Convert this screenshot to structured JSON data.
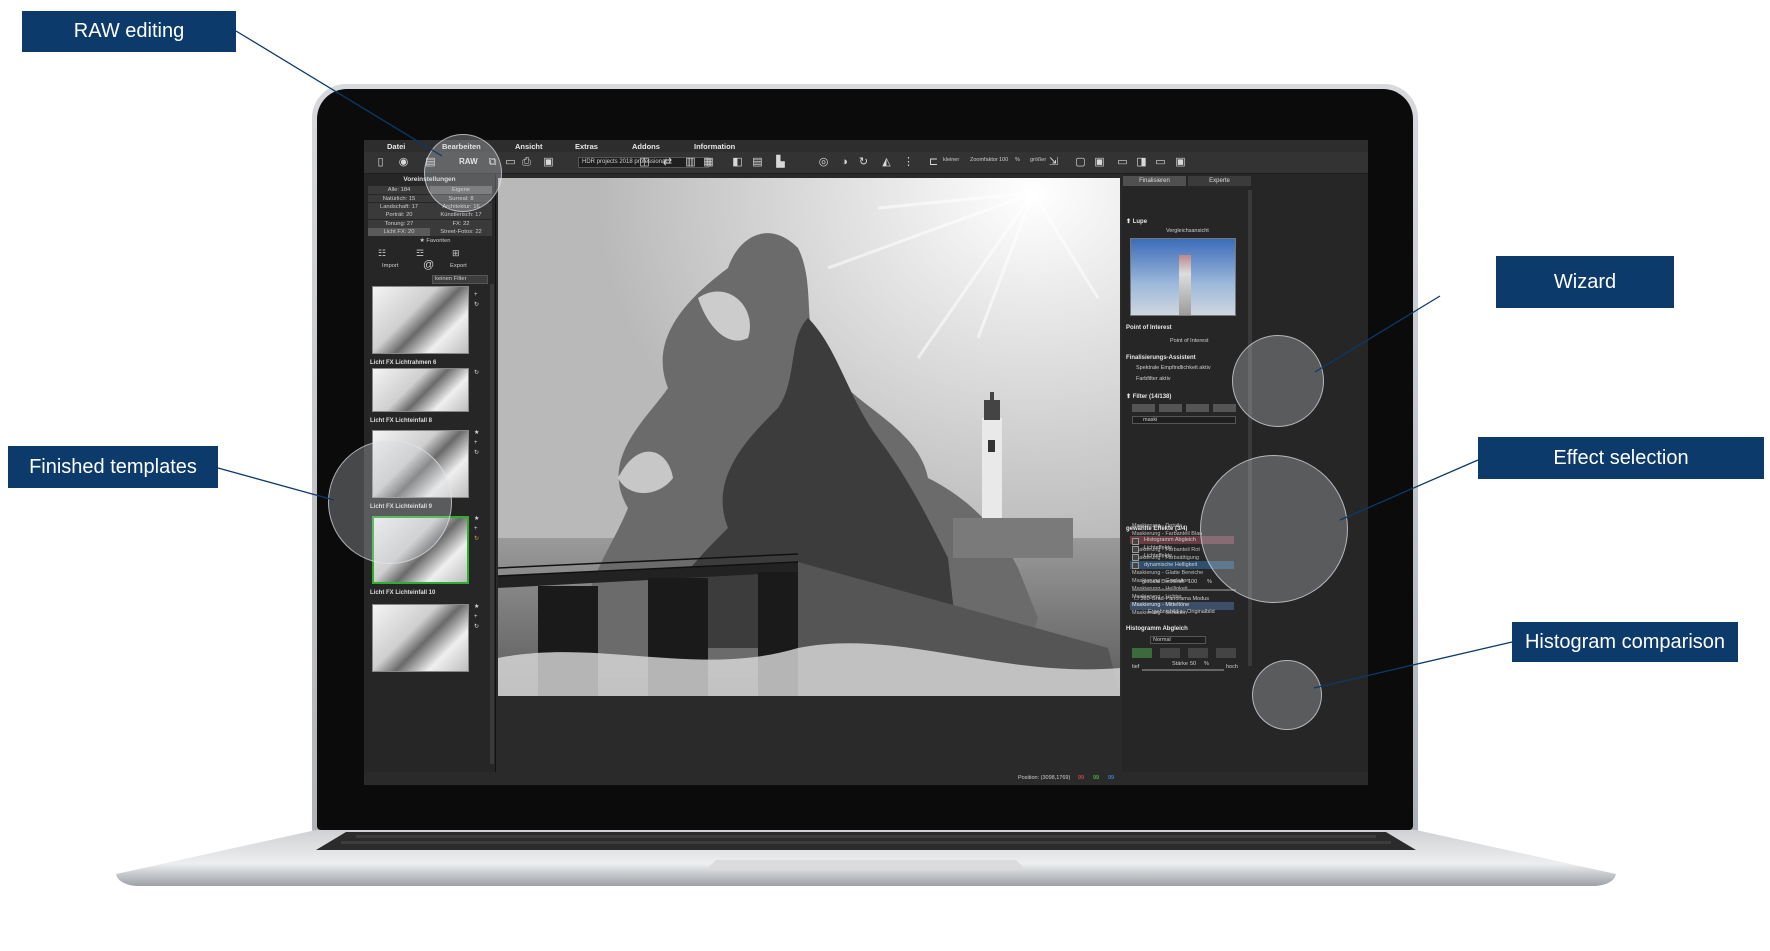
{
  "callouts": {
    "raw_editing": "RAW editing",
    "finished_templates": "Finished templates",
    "wizard": "Wizard",
    "effect_selection": "Effect selection",
    "histogram_comparison": "Histogram comparison"
  },
  "menu": [
    "Datei",
    "Bearbeiten",
    "Ansicht",
    "Extras",
    "Addons",
    "Information"
  ],
  "toolbar": {
    "raw_label": "RAW",
    "preset_dropdown": "HDR projects 2018 professional",
    "zoom_small": "kleiner",
    "zoom_label": "Zoomfaktor",
    "zoom_value": "100",
    "zoom_unit": "%",
    "zoom_large": "größer"
  },
  "left_panel": {
    "title": "Voreinstellungen",
    "categories": [
      [
        "Alle: 184",
        "Eigene"
      ],
      [
        "Natürlich: 15",
        "Surreal: 8"
      ],
      [
        "Landschaft: 17",
        "Architektur: 16"
      ],
      [
        "Porträt: 20",
        "Künstlerisch: 17"
      ],
      [
        "Tonung: 27",
        "FX: 22"
      ],
      [
        "Licht FX: 20",
        "Street-Fotos: 22"
      ]
    ],
    "favorites": "Favoriten",
    "import": "Import",
    "export": "Export",
    "filter": "keinen Filter",
    "thumbnails": [
      "Licht FX Lichtrahmen 6",
      "Licht FX Lichteinfall 8",
      "Licht FX Lichteinfall 9",
      "Licht FX Lichteinfall 10"
    ]
  },
  "right_panel": {
    "tab_finalize": "Finalisieren",
    "tab_expert": "Experte",
    "loupe": "Lupe",
    "compare_view": "Vergleichsansicht",
    "poi": "Point of Interest",
    "poi_button": "Point of Interest",
    "wizard_title": "Finalisierungs-Assistent",
    "wizard_opt1": "Spektrale Empfindlichkeit aktiv",
    "wizard_opt2": "Farbfilter aktiv",
    "filter_title": "Filter (14/138)",
    "search_value": "maski",
    "effects": [
      "Maskierung - Details",
      "Maskierung - Farbanteil Blau",
      "Maskierung - Farbanteil Grün",
      "Maskierung - Farbanteil Rot",
      "Maskierung - Farbsättigung",
      "Maskierung - Farbton",
      "Maskierung - Glatte Bereiche",
      "Maskierung - Gradation",
      "Maskierung - Helligkeit",
      "Maskierung - Lichter",
      "Maskierung - Mitteltöne",
      "Maskierung - Schatten"
    ],
    "chosen_title": "gewählte Effekte (3/4)",
    "chosen": [
      "Histogramm Abgleich",
      "Lichteffekte",
      "Lichteffekte",
      "dynamische Helligkeit"
    ],
    "opacity_label": "globale Deckkraft",
    "opacity_value": "100",
    "opacity_unit": "%",
    "panorama": "360-Grad-Panorama Modus",
    "original": "Ergebnisbild zu Originalbild",
    "hist_title": "Histogramm Abgleich",
    "hist_mode": "Normal",
    "strength_label": "Stärke",
    "strength_value": "50",
    "strength_unit": "%",
    "low": "tief",
    "high": "hoch"
  },
  "status": {
    "position": "Position: (3098,1769)",
    "r": "99",
    "g": "99",
    "b": "99"
  },
  "colors": {
    "callout_bg": "#0b3a6b",
    "selected_thumb_border": "#2fae2f"
  }
}
